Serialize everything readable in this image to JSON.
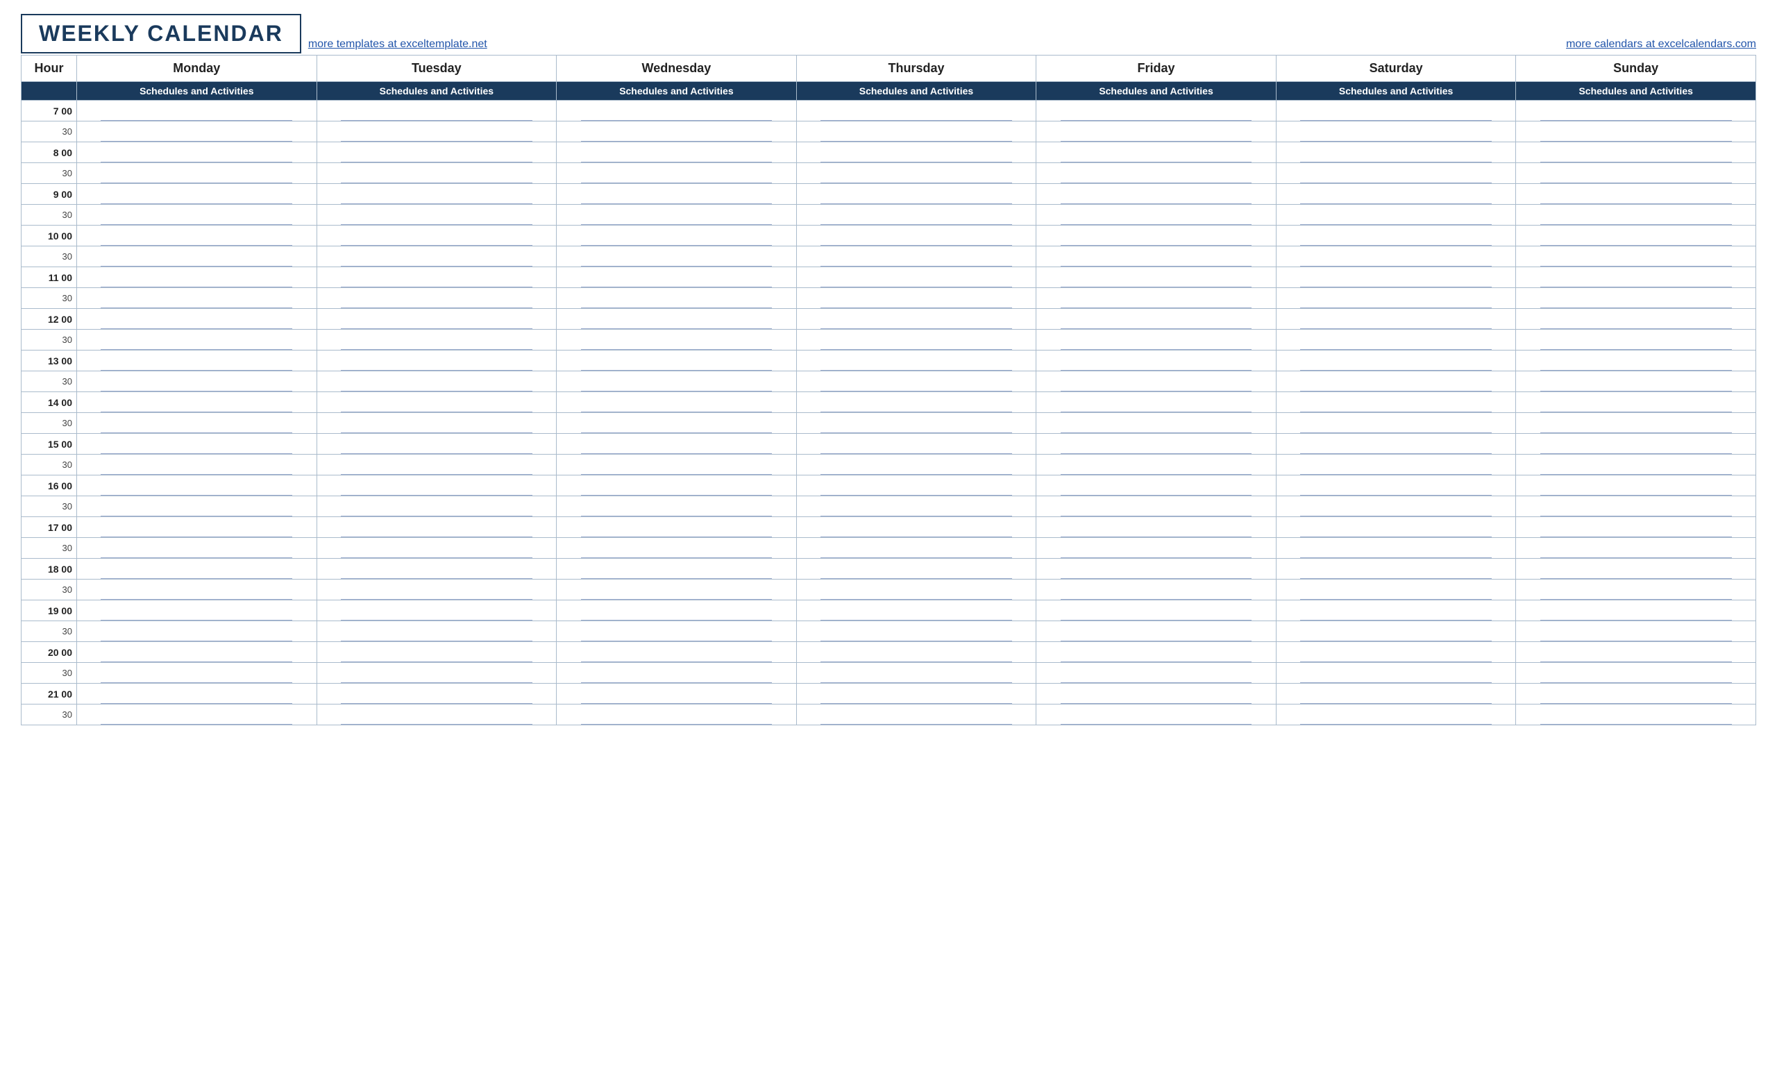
{
  "header": {
    "title": "WEEKLY CALENDAR",
    "watermark_left": "more templates at exceltemplate.net",
    "watermark_right": "more calendars at excelcalendars.com"
  },
  "table": {
    "hour_label": "Hour",
    "sub_label": "Schedules and Activities",
    "days": [
      "Monday",
      "Tuesday",
      "Wednesday",
      "Thursday",
      "Friday",
      "Saturday",
      "Sunday"
    ],
    "hours": [
      {
        "hour": "7",
        "label_hour": "7  00",
        "label_half": "30"
      },
      {
        "hour": "8",
        "label_hour": "8  00",
        "label_half": "30"
      },
      {
        "hour": "9",
        "label_hour": "9  00",
        "label_half": "30"
      },
      {
        "hour": "10",
        "label_hour": "10  00",
        "label_half": "30"
      },
      {
        "hour": "11",
        "label_hour": "11  00",
        "label_half": "30"
      },
      {
        "hour": "12",
        "label_hour": "12  00",
        "label_half": "30"
      },
      {
        "hour": "13",
        "label_hour": "13  00",
        "label_half": "30"
      },
      {
        "hour": "14",
        "label_hour": "14  00",
        "label_half": "30"
      },
      {
        "hour": "15",
        "label_hour": "15  00",
        "label_half": "30"
      },
      {
        "hour": "16",
        "label_hour": "16  00",
        "label_half": "30"
      },
      {
        "hour": "17",
        "label_hour": "17  00",
        "label_half": "30"
      },
      {
        "hour": "18",
        "label_hour": "18  00",
        "label_half": "30"
      },
      {
        "hour": "19",
        "label_hour": "19  00",
        "label_half": "30"
      },
      {
        "hour": "20",
        "label_hour": "20  00",
        "label_half": "30"
      },
      {
        "hour": "21",
        "label_hour": "21  00",
        "label_half": "30"
      }
    ]
  }
}
